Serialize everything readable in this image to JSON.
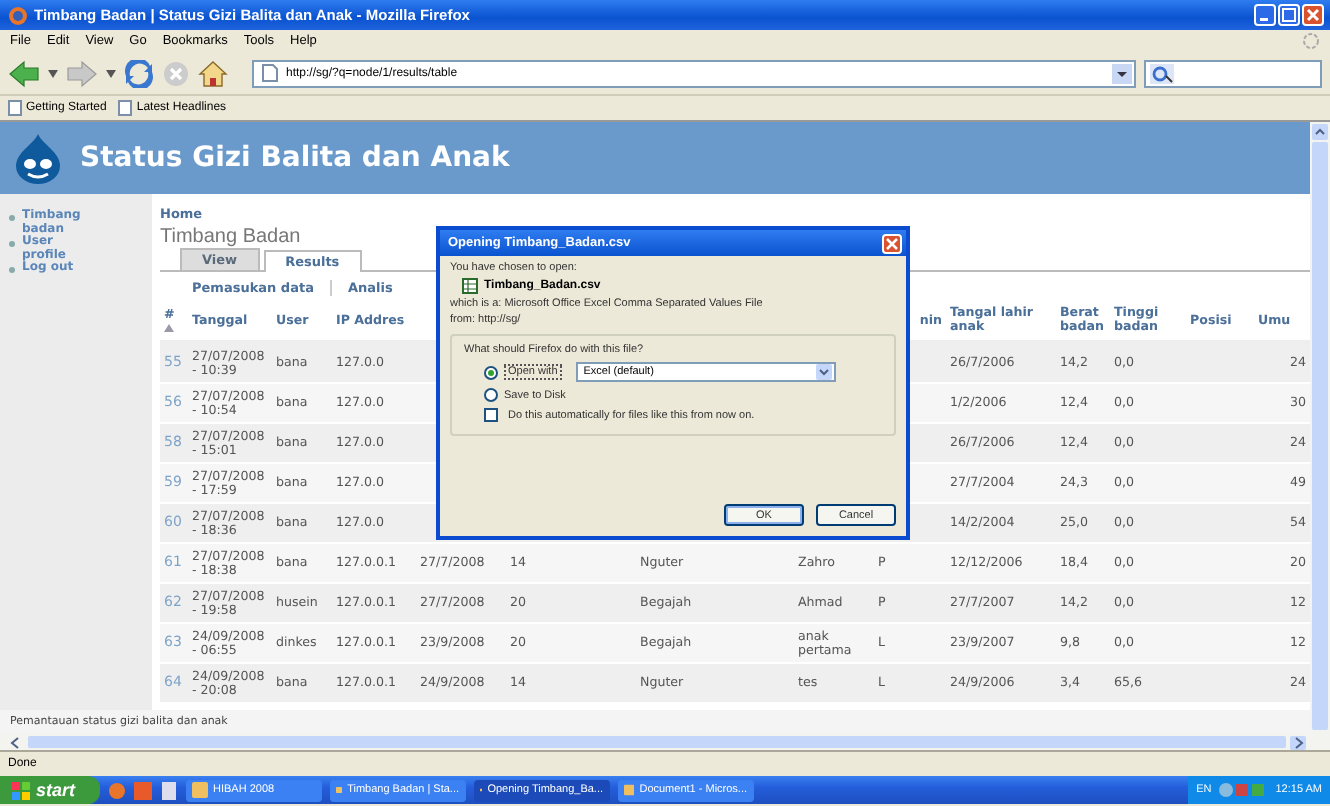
{
  "window": {
    "title": "Timbang Badan | Status Gizi Balita dan Anak - Mozilla Firefox"
  },
  "menu": [
    "File",
    "Edit",
    "View",
    "Go",
    "Bookmarks",
    "Tools",
    "Help"
  ],
  "address_bar": {
    "value": "http://sg/?q=node/1/results/table"
  },
  "bookmarks": [
    "Getting Started",
    "Latest Headlines"
  ],
  "site": {
    "title": "Status Gizi Balita dan Anak"
  },
  "sidebar": {
    "items": [
      "Timbang badan",
      "User profile",
      "Log out"
    ]
  },
  "breadcrumb": "Home",
  "page_title": "Timbang Badan",
  "tabs": [
    {
      "label": "View",
      "selected": false
    },
    {
      "label": "Results",
      "selected": true
    }
  ],
  "subtabs": [
    "Pemasukan data",
    "Analis"
  ],
  "table": {
    "columns": [
      "#",
      "Tanggal",
      "User",
      "IP Addres",
      null,
      null,
      null,
      null,
      "nin",
      "Tangal lahir anak",
      "Berat badan",
      "Tinggi badan",
      "Posisi",
      "Umu"
    ],
    "rows": [
      {
        "cells": [
          "55",
          "27/07/2008 - 10:39",
          "bana",
          "127.0.0",
          null,
          null,
          null,
          null,
          null,
          "26/7/2006",
          "14,2",
          "0,0",
          null,
          "24"
        ]
      },
      {
        "cells": [
          "56",
          "27/07/2008 - 10:54",
          "bana",
          "127.0.0",
          null,
          null,
          null,
          null,
          null,
          "1/2/2006",
          "12,4",
          "0,0",
          null,
          "30"
        ]
      },
      {
        "cells": [
          "58",
          "27/07/2008 - 15:01",
          "bana",
          "127.0.0",
          null,
          null,
          null,
          null,
          null,
          "26/7/2006",
          "12,4",
          "0,0",
          null,
          "24"
        ]
      },
      {
        "cells": [
          "59",
          "27/07/2008 - 17:59",
          "bana",
          "127.0.0",
          null,
          null,
          null,
          null,
          null,
          "27/7/2004",
          "24,3",
          "0,0",
          null,
          "49"
        ]
      },
      {
        "cells": [
          "60",
          "27/07/2008 - 18:36",
          "bana",
          "127.0.0",
          null,
          null,
          null,
          null,
          null,
          "14/2/2004",
          "25,0",
          "0,0",
          null,
          "54"
        ]
      },
      {
        "cells": [
          "61",
          "27/07/2008 - 18:38",
          "bana",
          "127.0.0.1",
          "27/7/2008",
          "14",
          "Nguter",
          "Zahro",
          "P",
          "12/12/2006",
          "18,4",
          "0,0",
          null,
          "20"
        ]
      },
      {
        "cells": [
          "62",
          "27/07/2008 - 19:58",
          "husein",
          "127.0.0.1",
          "27/7/2008",
          "20",
          "Begajah",
          "Ahmad",
          "P",
          "27/7/2007",
          "14,2",
          "0,0",
          null,
          "12"
        ]
      },
      {
        "cells": [
          "63",
          "24/09/2008 - 06:55",
          "dinkes",
          "127.0.0.1",
          "23/9/2008",
          "20",
          "Begajah",
          "anak pertama",
          "L",
          "23/9/2007",
          "9,8",
          "0,0",
          null,
          "12"
        ]
      },
      {
        "cells": [
          "64",
          "24/09/2008 - 20:08",
          "bana",
          "127.0.0.1",
          "24/9/2008",
          "14",
          "Nguter",
          "tes",
          "L",
          "24/9/2006",
          "3,4",
          "65,6",
          null,
          "24"
        ]
      }
    ]
  },
  "footer": "Pemantauan status gizi balita dan anak",
  "status_bar": "Done",
  "dialog": {
    "title": "Opening Timbang_Badan.csv",
    "intro": "You have chosen to open:",
    "file_name": "Timbang_Badan.csv",
    "type_line": "which is a: Microsoft Office Excel Comma Separated Values File",
    "from_line": "from: http://sg/",
    "group_title": "What should Firefox do with this file?",
    "options": [
      {
        "label": "Open with",
        "selected": true
      },
      {
        "label": "Save to Disk",
        "selected": false
      }
    ],
    "application": "Excel (default)",
    "auto": {
      "label": "Do this automatically for files like this from now on.",
      "checked": false
    },
    "buttons": [
      "OK",
      "Cancel"
    ]
  },
  "taskbar": {
    "start": "start",
    "tasks": [
      {
        "label": "HIBAH 2008",
        "selected": false
      },
      {
        "label": "Timbang Badan | Sta...",
        "selected": false
      },
      {
        "label": "Opening Timbang_Ba...",
        "selected": true
      },
      {
        "label": "Document1 - Micros...",
        "selected": false
      }
    ],
    "language": "EN",
    "clock": "12:15 AM"
  }
}
